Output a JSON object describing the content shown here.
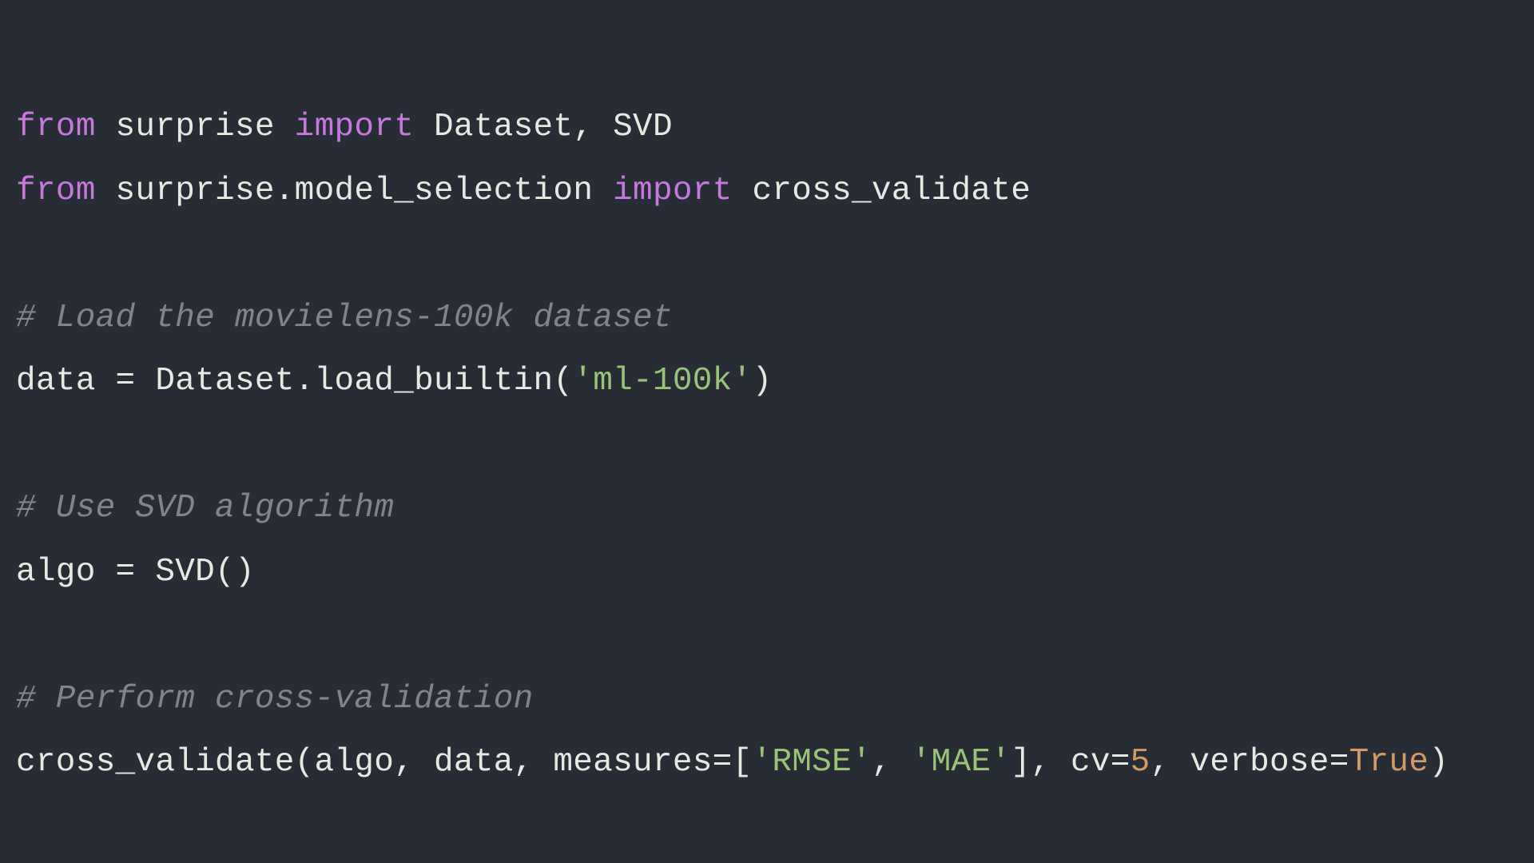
{
  "colors": {
    "background": "#282c34",
    "text": "#e8e8e3",
    "keyword": "#c678dd",
    "comment": "#7f848e",
    "string": "#98c379",
    "number": "#d19a66"
  },
  "code": {
    "language": "python",
    "lines": [
      {
        "tokens": [
          {
            "t": "from ",
            "c": "kw"
          },
          {
            "t": "surprise ",
            "c": "plain"
          },
          {
            "t": "import ",
            "c": "kw"
          },
          {
            "t": "Dataset, SVD",
            "c": "plain"
          }
        ]
      },
      {
        "tokens": [
          {
            "t": "from ",
            "c": "kw"
          },
          {
            "t": "surprise.model_selection ",
            "c": "plain"
          },
          {
            "t": "import ",
            "c": "kw"
          },
          {
            "t": "cross_validate",
            "c": "plain"
          }
        ]
      },
      {
        "tokens": []
      },
      {
        "tokens": [
          {
            "t": "# Load the movielens-100k dataset",
            "c": "cmt"
          }
        ]
      },
      {
        "tokens": [
          {
            "t": "data = Dataset.load_builtin(",
            "c": "plain"
          },
          {
            "t": "'ml-100k'",
            "c": "str"
          },
          {
            "t": ")",
            "c": "plain"
          }
        ]
      },
      {
        "tokens": []
      },
      {
        "tokens": [
          {
            "t": "# Use SVD algorithm",
            "c": "cmt"
          }
        ]
      },
      {
        "tokens": [
          {
            "t": "algo = SVD()",
            "c": "plain"
          }
        ]
      },
      {
        "tokens": []
      },
      {
        "tokens": [
          {
            "t": "# Perform cross-validation",
            "c": "cmt"
          }
        ]
      },
      {
        "tokens": [
          {
            "t": "cross_validate(algo, data, measures=[",
            "c": "plain"
          },
          {
            "t": "'RMSE'",
            "c": "str"
          },
          {
            "t": ", ",
            "c": "plain"
          },
          {
            "t": "'MAE'",
            "c": "str"
          },
          {
            "t": "], cv=",
            "c": "plain"
          },
          {
            "t": "5",
            "c": "num"
          },
          {
            "t": ", verbose=",
            "c": "plain"
          },
          {
            "t": "True",
            "c": "bool"
          },
          {
            "t": ")",
            "c": "plain"
          }
        ]
      }
    ]
  }
}
